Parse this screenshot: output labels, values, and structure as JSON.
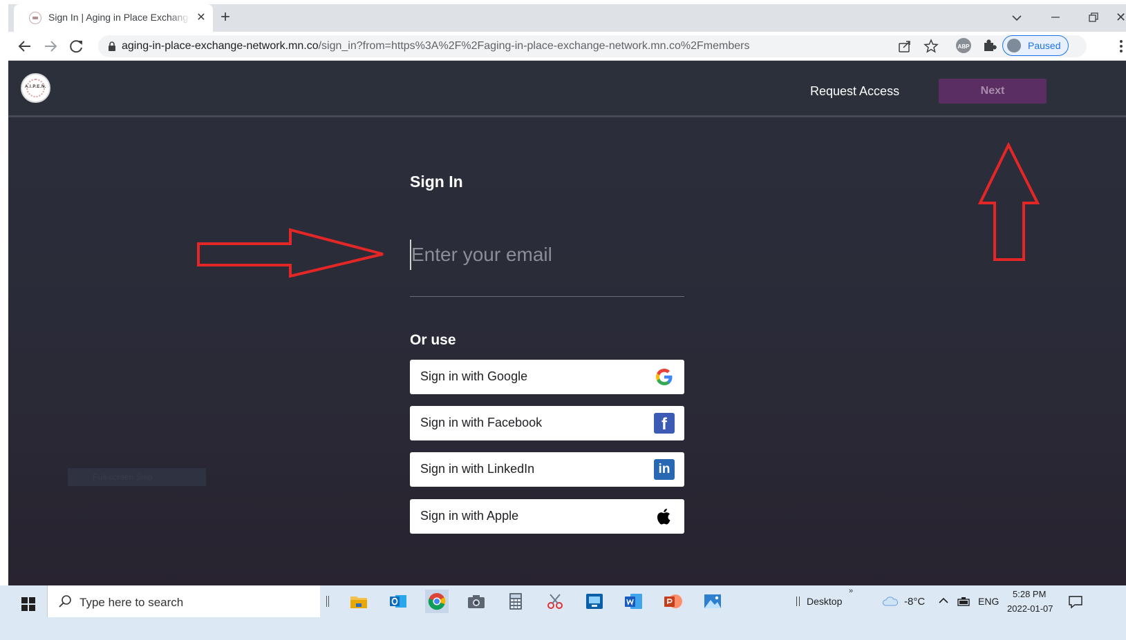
{
  "browser": {
    "tab_title": "Sign In | Aging in Place Exchange",
    "url_host": "aging-in-place-exchange-network.mn.co",
    "url_path": "/sign_in?from=https%3A%2F%2Faging-in-place-exchange-network.mn.co%2Fmembers",
    "profile_status": "Paused",
    "ext_abp_label": "ABP",
    "new_tab_glyph": "+",
    "close_glyph": "✕",
    "icons": [
      "favicon-icon",
      "back-icon",
      "forward-icon",
      "reload-icon",
      "lock-icon",
      "share-icon",
      "star-icon",
      "adblock-icon",
      "puzzle-icon",
      "menu-icon"
    ]
  },
  "site": {
    "logo_text": "A.I.P.E.N.",
    "request_access": "Request Access",
    "next": "Next"
  },
  "signin": {
    "title": "Sign In",
    "email_placeholder": "Enter your email",
    "or_use": "Or use",
    "providers": [
      {
        "label": "Sign in with Google",
        "icon": "google-icon"
      },
      {
        "label": "Sign in with Facebook",
        "icon": "facebook-icon",
        "glyph": "f"
      },
      {
        "label": "Sign in with LinkedIn",
        "icon": "linkedin-icon",
        "glyph": "in"
      },
      {
        "label": "Sign in with Apple",
        "icon": "apple-icon"
      }
    ],
    "ghost_snip_text": "Full-screen Snip"
  },
  "annotations": {
    "arrow_color": "#e32626"
  },
  "taskbar": {
    "search_placeholder": "Type here to search",
    "apps": [
      "file-explorer-icon",
      "outlook-icon",
      "chrome-icon",
      "camera-icon",
      "calculator-icon",
      "snip-icon",
      "remote-desktop-icon",
      "word-icon",
      "powerpoint-icon",
      "photos-icon"
    ],
    "desktop_label": "Desktop",
    "temperature": "-8°C",
    "language": "ENG",
    "time": "5:28 PM",
    "date": "2022-01-07"
  },
  "colors": {
    "page_bg": "#2b2f3b",
    "next_button": "#5a2e62",
    "arrow": "#e32626"
  }
}
